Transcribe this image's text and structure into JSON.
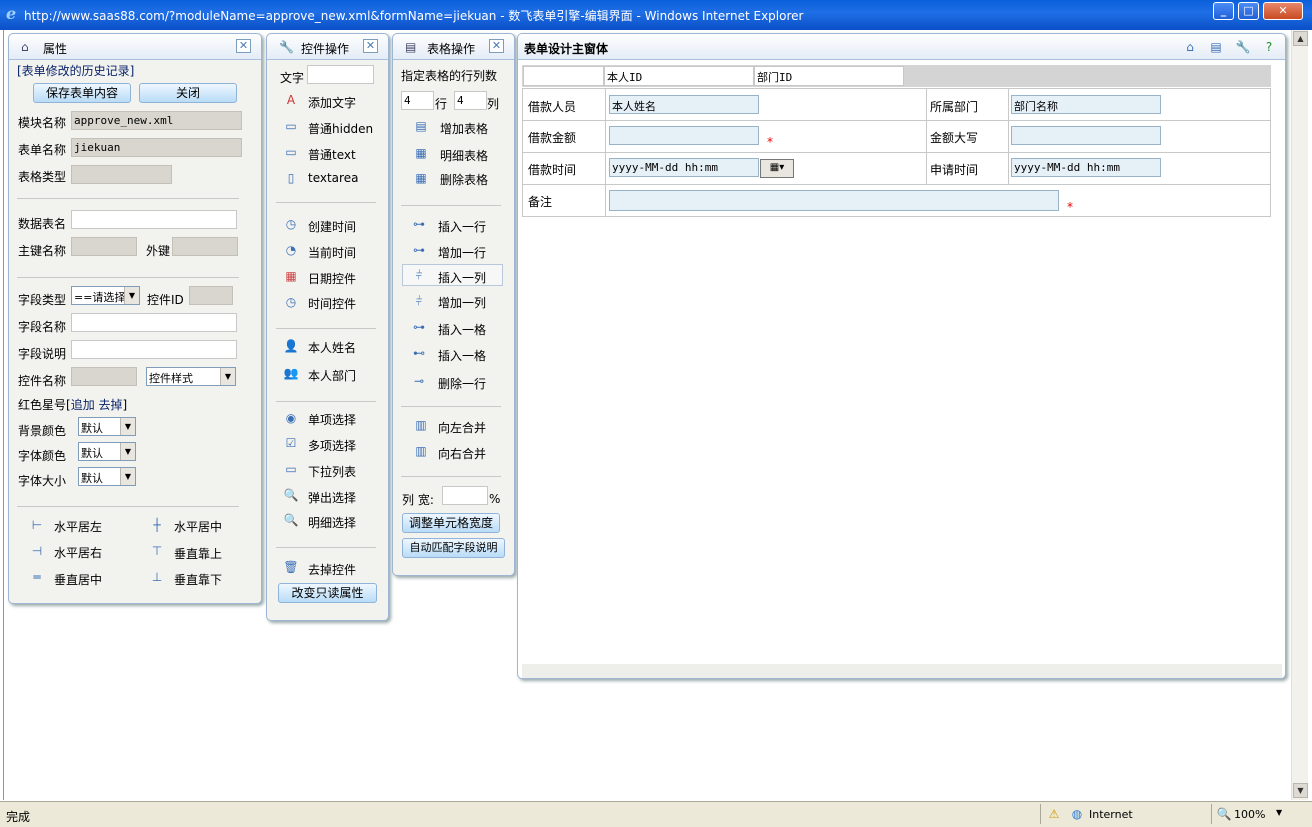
{
  "window": {
    "title": "http://www.saas88.com/?moduleName=approve_new.xml&formName=jiekuan - 数飞表单引擎-编辑界面 - Windows Internet Explorer",
    "minimize": "0",
    "maximize": "1",
    "close": "r"
  },
  "status": {
    "text": "完成",
    "zone": "Internet",
    "zoom": "100%"
  },
  "props": {
    "title": "属性",
    "history": "[表单修改的历史记录]",
    "save_btn": "保存表单内容",
    "close_btn": "关闭",
    "module_label": "模块名称",
    "module_value": "approve_new.xml",
    "form_label": "表单名称",
    "form_value": "jiekuan",
    "table_type_label": "表格类型",
    "data_table_label": "数据表名",
    "pk_label": "主键名称",
    "fk_label": "外键",
    "field_type_label": "字段类型",
    "field_type_value": "==请选择",
    "control_id_label": "控件ID",
    "field_name_label": "字段名称",
    "field_desc_label": "字段说明",
    "control_name_label": "控件名称",
    "control_style_value": "控件样式",
    "star_label": "红色星号[",
    "star_add": "追加",
    "star_remove": "去掉",
    "star_close": "]",
    "bg_color_label": "背景颜色",
    "font_color_label": "字体颜色",
    "font_size_label": "字体大小",
    "default_value": "默认",
    "align": {
      "left": "水平居左",
      "center": "水平居中",
      "right": "水平居右",
      "top": "垂直靠上",
      "middle": "垂直居中",
      "bottom": "垂直靠下"
    }
  },
  "controls": {
    "title": "控件操作",
    "text_label": "文字",
    "items": {
      "add_text": "添加文字",
      "hidden": "普通hidden",
      "text": "普通text",
      "textarea": "textarea",
      "create_time": "创建时间",
      "now_time": "当前时间",
      "date_ctrl": "日期控件",
      "time_ctrl": "时间控件",
      "my_name": "本人姓名",
      "my_dept": "本人部门",
      "radio": "单项选择",
      "checkbox": "多项选择",
      "dropdown": "下拉列表",
      "popup": "弹出选择",
      "detail": "明细选择",
      "remove": "去掉控件"
    },
    "readonly_btn": "改变只读属性"
  },
  "tableops": {
    "title": "表格操作",
    "rc_label": "指定表格的行列数",
    "rows_value": "4",
    "rows_label": "行",
    "cols_value": "4",
    "cols_label": "列",
    "items": {
      "add_table": "增加表格",
      "detail_table": "明细表格",
      "del_table": "删除表格",
      "insert_row": "插入一行",
      "add_row": "增加一行",
      "insert_col": "插入一列",
      "add_col": "增加一列",
      "insert_cell1": "插入一格",
      "insert_cell2": "插入一格",
      "del_row": "删除一行",
      "merge_left": "向左合并",
      "merge_right": "向右合并"
    },
    "width_label": "列 宽:",
    "width_unit": "%",
    "adjust_btn": "调整单元格宽度",
    "auto_btn": "自动匹配字段说明"
  },
  "main": {
    "title": "表单设计主窗体",
    "header_cells": [
      "",
      "本人ID",
      "部门ID"
    ],
    "rows": [
      {
        "l1": "借款人员",
        "v1": "本人姓名",
        "l2": "所属部门",
        "v2": "部门名称"
      },
      {
        "l1": "借款金额",
        "v1": "",
        "star1": "*",
        "l2": "金额大写",
        "v2": ""
      },
      {
        "l1": "借款时间",
        "v1": "yyyy-MM-dd hh:mm",
        "l2": "申请时间",
        "v2": "yyyy-MM-dd hh:mm"
      },
      {
        "l1": "备注",
        "v1": "",
        "star1": "*"
      }
    ]
  },
  "colors": {
    "titlebar": "#0a5fd9",
    "panel_border": "#9eb6d4",
    "button": "#b9dcf7",
    "required_star": "#e00000"
  }
}
